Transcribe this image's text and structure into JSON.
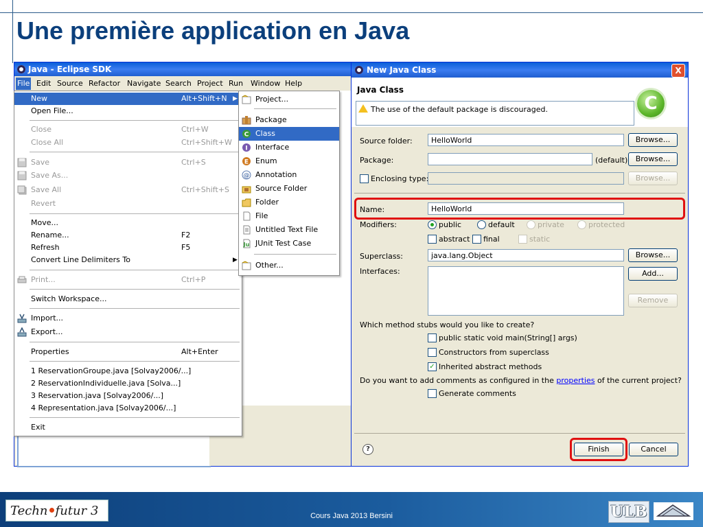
{
  "slide": {
    "title": "Une première application en Java",
    "footer_text": "Cours Java 2013 Bersini",
    "logo_left_a": "Techn",
    "logo_left_b": "futur 3",
    "logo_right": "ULB"
  },
  "eclipse": {
    "title": "Java - Eclipse SDK",
    "menubar": [
      "File",
      "Edit",
      "Source",
      "Refactor",
      "Navigate",
      "Search",
      "Project",
      "Run",
      "Window",
      "Help"
    ]
  },
  "file_menu": {
    "items": [
      {
        "label": "New",
        "shortcut": "Alt+Shift+N"
      },
      {
        "label": "Open File...",
        "shortcut": ""
      },
      {
        "label": "Close",
        "shortcut": "Ctrl+W"
      },
      {
        "label": "Close All",
        "shortcut": "Ctrl+Shift+W"
      },
      {
        "label": "Save",
        "shortcut": "Ctrl+S"
      },
      {
        "label": "Save As...",
        "shortcut": ""
      },
      {
        "label": "Save All",
        "shortcut": "Ctrl+Shift+S"
      },
      {
        "label": "Revert",
        "shortcut": ""
      },
      {
        "label": "Move...",
        "shortcut": ""
      },
      {
        "label": "Rename...",
        "shortcut": "F2"
      },
      {
        "label": "Refresh",
        "shortcut": "F5"
      },
      {
        "label": "Convert Line Delimiters To",
        "shortcut": ""
      },
      {
        "label": "Print...",
        "shortcut": "Ctrl+P"
      },
      {
        "label": "Switch Workspace...",
        "shortcut": ""
      },
      {
        "label": "Import...",
        "shortcut": ""
      },
      {
        "label": "Export...",
        "shortcut": ""
      },
      {
        "label": "Properties",
        "shortcut": "Alt+Enter"
      },
      {
        "label": "1 ReservationGroupe.java  [Solvay2006/...]",
        "shortcut": ""
      },
      {
        "label": "2 ReservationIndividuelle.java  [Solva...]",
        "shortcut": ""
      },
      {
        "label": "3 Reservation.java  [Solvay2006/...]",
        "shortcut": ""
      },
      {
        "label": "4 Representation.java  [Solvay2006/...]",
        "shortcut": ""
      },
      {
        "label": "Exit",
        "shortcut": ""
      }
    ]
  },
  "new_submenu": {
    "items": [
      "Project...",
      "Package",
      "Class",
      "Interface",
      "Enum",
      "Annotation",
      "Source Folder",
      "Folder",
      "File",
      "Untitled Text File",
      "JUnit Test Case",
      "Other..."
    ]
  },
  "dialog": {
    "title": "New Java Class",
    "header": "Java Class",
    "warning": "The use of the default package is discouraged.",
    "source_folder_label": "Source folder:",
    "source_folder_value": "HelloWorld",
    "package_label": "Package:",
    "package_value": "",
    "package_default": "(default)",
    "enclosing_label": "Enclosing type:",
    "name_label": "Name:",
    "name_value": "HelloWorld",
    "modifiers_label": "Modifiers:",
    "mod_public": "public",
    "mod_default": "default",
    "mod_private": "private",
    "mod_protected": "protected",
    "mod_abstract": "abstract",
    "mod_final": "final",
    "mod_static": "static",
    "superclass_label": "Superclass:",
    "superclass_value": "java.lang.Object",
    "interfaces_label": "Interfaces:",
    "browse": "Browse...",
    "add": "Add...",
    "remove": "Remove",
    "stubs_question": "Which method stubs would you like to create?",
    "stub_main": "public static void main(String[] args)",
    "stub_constructors": "Constructors from superclass",
    "stub_inherited": "Inherited abstract methods",
    "comments_q_a": "Do you want to add comments as configured in the",
    "comments_link": "properties",
    "comments_q_b": "of the current project?",
    "generate_comments": "Generate comments",
    "finish": "Finish",
    "cancel": "Cancel",
    "help": "?",
    "close": "X"
  }
}
